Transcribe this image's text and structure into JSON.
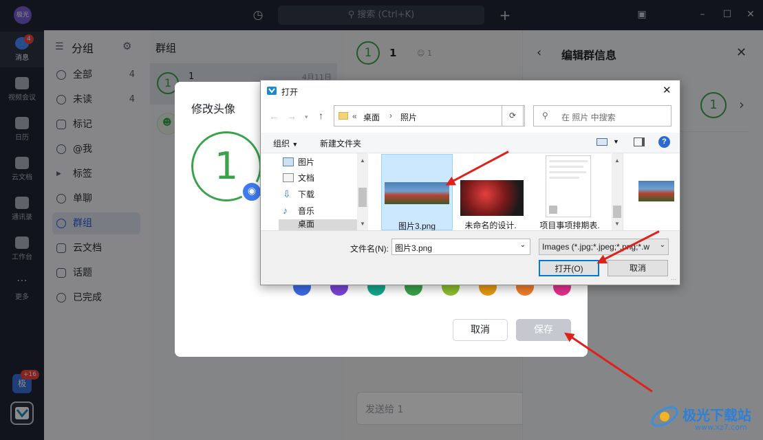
{
  "topbar": {
    "avatar_text": "极光",
    "search_placeholder": "搜索 (Ctrl+K)"
  },
  "rail": {
    "items": [
      {
        "label": "消息",
        "badge": "4"
      },
      {
        "label": "视频会议"
      },
      {
        "label": "日历"
      },
      {
        "label": "云文档"
      },
      {
        "label": "通讯录"
      },
      {
        "label": "工作台"
      },
      {
        "label": "更多"
      }
    ],
    "bottom_avatar_text": "极",
    "bottom_badge": "+16"
  },
  "groups_panel": {
    "title": "分组",
    "items": [
      {
        "label": "全部",
        "count": "4"
      },
      {
        "label": "未读",
        "count": "4"
      },
      {
        "label": "标记"
      },
      {
        "label": "@我"
      },
      {
        "label": "标签"
      },
      {
        "label": "单聊"
      },
      {
        "label": "群组"
      },
      {
        "label": "云文档"
      },
      {
        "label": "话题"
      },
      {
        "label": "已完成"
      }
    ]
  },
  "chat_list": {
    "title": "群组",
    "items": [
      {
        "avatar": "1",
        "name": "1",
        "date": "4月11日"
      }
    ]
  },
  "chat_header": {
    "avatar": "1",
    "name": "1",
    "member_count": "1"
  },
  "chat_input_placeholder": "发送给 1",
  "group_info": {
    "title": "编辑群信息",
    "avatar": "1"
  },
  "avatar_modal": {
    "title": "修改头像",
    "preview_text": "1",
    "cancel_label": "取消",
    "save_label": "保存",
    "swatches": [
      "#3c6be8",
      "#7a45d8",
      "#14a88c",
      "#3aa24a",
      "#8cbf2c",
      "#e59a12",
      "#ef7e2c",
      "#e4318c"
    ]
  },
  "file_dialog": {
    "title": "打开",
    "path": [
      "桌面",
      "照片"
    ],
    "path_prefix": "«",
    "search_placeholder": "在 照片 中搜索",
    "toolbar": {
      "organize": "组织",
      "new_folder": "新建文件夹"
    },
    "tree": [
      "图片",
      "文档",
      "下载",
      "音乐",
      "桌面"
    ],
    "files": [
      {
        "name": "图片3.png"
      },
      {
        "name": "未命名的设计."
      },
      {
        "name": "项目事项排期表."
      }
    ],
    "filename_label": "文件名(N):",
    "filename_value": "图片3.png",
    "filetype_value": "Images (*.jpg;*.jpeg;*.png;*.w",
    "open_label": "打开(O)",
    "cancel_label": "取消"
  },
  "watermark": {
    "text": "极光下载站",
    "url": "www.xz7.com"
  }
}
